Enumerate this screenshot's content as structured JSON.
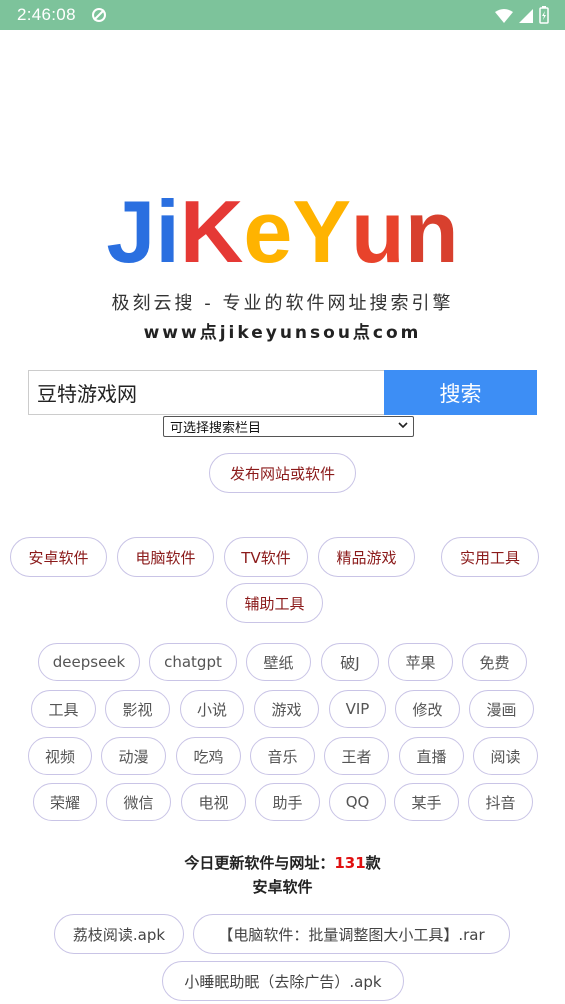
{
  "status_bar": {
    "time": "2:46:08"
  },
  "logo": {
    "letters": [
      {
        "char": "J",
        "color": "#2a6fe0"
      },
      {
        "char": "i",
        "color": "#2a6fe0"
      },
      {
        "char": "K",
        "color": "#e53935"
      },
      {
        "char": "e",
        "color": "#ffb300"
      },
      {
        "char": "Y",
        "color": "#ffb300"
      },
      {
        "char": "u",
        "color": "#e8432b"
      },
      {
        "char": "n",
        "color": "#d8402e"
      }
    ]
  },
  "tagline": "极刻云搜 - 专业的软件网址搜索引擎",
  "domain_text": "www点jikeyunsou点com",
  "search": {
    "value": "豆特游戏网",
    "button_label": "搜索",
    "select_value": "可选择搜索栏目"
  },
  "publish_label": "发布网站或软件",
  "categories": [
    "安卓软件",
    "电脑软件",
    "TV软件",
    "精品游戏",
    "实用工具",
    "辅助工具"
  ],
  "tags": [
    "deepseek",
    "chatgpt",
    "壁纸",
    "破J",
    "苹果",
    "免费",
    "工具",
    "影视",
    "小说",
    "游戏",
    "VIP",
    "修改",
    "漫画",
    "视频",
    "动漫",
    "吃鸡",
    "音乐",
    "王者",
    "直播",
    "阅读",
    "荣耀",
    "微信",
    "电视",
    "助手",
    "QQ",
    "某手",
    "抖音"
  ],
  "update": {
    "prefix": "今日更新软件与网址：",
    "count": "131",
    "suffix": "款",
    "category": "安卓软件"
  },
  "files": [
    "荔枝阅读.apk",
    "【电脑软件：批量调整图大小工具】.rar",
    "小睡眠助眠（去除广告）.apk"
  ],
  "colors": {
    "status_bar": "#7dc39b",
    "accent": "#3d8ef5",
    "category_text": "#8b1a1a",
    "count": "#e01010"
  }
}
